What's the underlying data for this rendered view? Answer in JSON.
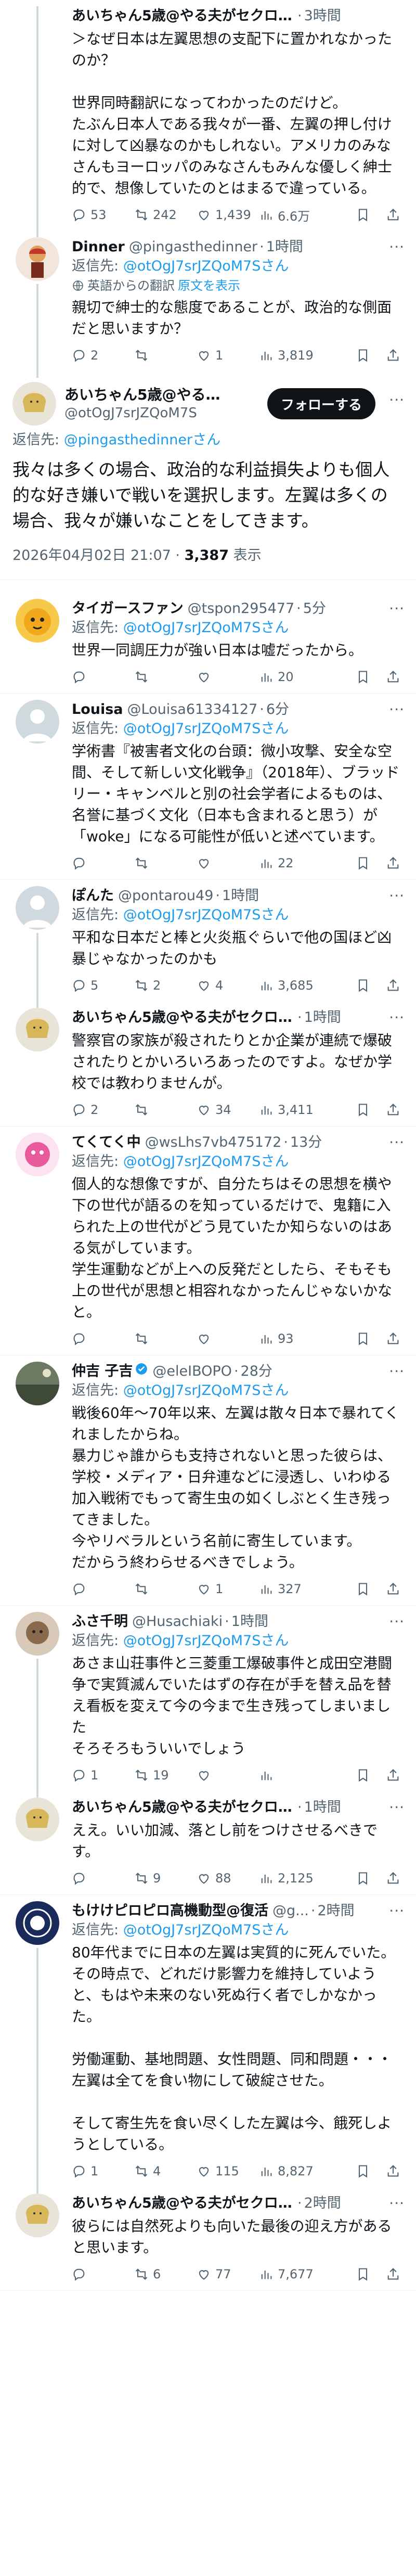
{
  "tweets_top": {
    "t1": {
      "name": "あいちゃん5歳@やる夫がセクロス…",
      "time": "3時間",
      "body": "＞なぜ日本は左翼思想の支配下に置かれなかったのか？\n\n世界同時翻訳になってわかったのだけど。\nたぶん日本人である我々が一番、左翼の押し付けに対して凶暴なのかもしれない。アメリカのみなさんもヨーロッパのみなさんもみんな優しく紳士的で、想像していたのとはまるで違っている。",
      "replies": "53",
      "retweets": "242",
      "likes": "1,439",
      "views": "6.6万"
    },
    "t2": {
      "name": "Dinner",
      "handle": "@pingasthedinner",
      "time": "1時間",
      "reply_to": "@otOgJ7srJZQoM7Sさん",
      "translated": "英語からの翻訳",
      "original": "原文を表示",
      "body": "親切で紳士的な態度であることが、政治的な側面だと思いますか？",
      "replies": "2",
      "retweets": "",
      "likes": "1",
      "views": "3,819"
    }
  },
  "main": {
    "name": "あいちゃん5歳@やる夫...",
    "handle": "@otOgJ7srJZQoM7S",
    "follow": "フォローする",
    "reply_prefix": "返信先: ",
    "reply_to": "@pingasthedinnerさん",
    "body": "我々は多くの場合、政治的な利益損失よりも個人的な好き嫌いで戦いを選択します。左翼は多くの場合、我々が嫌いなことをしてきます。",
    "timestamp": "2026年04月02日 21:07",
    "views_count": "3,387",
    "views_label": "表示"
  },
  "reply_prefix": "返信先: ",
  "replies": [
    {
      "name": "タイガースファン",
      "handle": "@tspon295477",
      "time": "5分",
      "reply_to": "@otOgJ7srJZQoM7Sさん",
      "body": "世界一同調圧力が強い日本は嘘だったから。",
      "replies": "",
      "retweets": "",
      "likes": "",
      "views": "20"
    },
    {
      "name": "Louisa",
      "handle": "@Louisa61334127",
      "time": "6分",
      "reply_to": "@otOgJ7srJZQoM7Sさん",
      "body": "学術書『被害者文化の台頭：微小攻撃、安全な空間、そして新しい文化戦争』（2018年）、ブラッドリー・キャンベルと別の社会学者によるものは、名誉に基づく文化（日本も含まれると思う）が「woke」になる可能性が低いと述べています。",
      "replies": "",
      "retweets": "",
      "likes": "",
      "views": "22"
    },
    {
      "name": "ぽんた",
      "handle": "@pontarou49",
      "time": "1時間",
      "reply_to": "@otOgJ7srJZQoM7Sさん",
      "body": "平和な日本だと棒と火炎瓶ぐらいで他の国ほど凶暴じゃなかったのかも",
      "replies": "5",
      "retweets": "2",
      "likes": "4",
      "views": "3,685"
    },
    {
      "name": "あいちゃん5歳@やる夫がセクロス…",
      "handle": "",
      "time": "1時間",
      "reply_to": "",
      "body": "警察官の家族が殺されたりとか企業が連続で爆破されたりとかいろいろあったのですよ。なぜか学校では教わりませんが。",
      "replies": "2",
      "retweets": "",
      "likes": "34",
      "views": "3,411"
    },
    {
      "name": "てくてく中",
      "handle": "@wsLhs7vb475172",
      "time": "13分",
      "reply_to": "@otOgJ7srJZQoM7Sさん",
      "body": "個人的な想像ですが、自分たちはその思想を横や下の世代が語るのを知っているだけで、鬼籍に入られた上の世代がどう見ていたか知らないのはある気がしています。\n学生運動などが上への反発だとしたら、そもそも上の世代が思想と相容れなかったんじゃないかなと。",
      "replies": "",
      "retweets": "",
      "likes": "",
      "views": "93"
    },
    {
      "name": "仲吉 子吉",
      "handle": "@eleIBOPO",
      "time": "28分",
      "reply_to": "@otOgJ7srJZQoM7Sさん",
      "body": "戦後60年〜70年以来、左翼は散々日本で暴れてくれましたからね。\n暴力じゃ誰からも支持されないと思った彼らは、学校・メディア・日弁連などに浸透し、いわゆる加入戦術でもって寄生虫の如くしぶとく生き残ってきました。\n今やリベラルという名前に寄生しています。\nだからう終わらせるべきでしょう。",
      "replies": "",
      "retweets": "",
      "likes": "1",
      "views": "327"
    },
    {
      "name": "ふさ千明",
      "handle": "@Husachiaki",
      "time": "1時間",
      "reply_to": "@otOgJ7srJZQoM7Sさん",
      "body": "あさま山荘事件と三菱重工爆破事件と成田空港闘争で実質滅んでいたはずの存在が手を替え品を替え看板を変えて今の今まで生き残ってしまいました\nそろそろもういいでしょう",
      "replies": "1",
      "retweets": "19",
      "likes": "",
      "views": ""
    },
    {
      "name": "あいちゃん5歳@やる夫がセクロス…",
      "handle": "",
      "time": "1時間",
      "reply_to": "",
      "body": "ええ。いい加減、落とし前をつけさせるべきです。",
      "replies": "",
      "retweets": "9",
      "likes": "88",
      "views": "2,125"
    },
    {
      "name": "もけけピロピロ高機動型@復活",
      "handle": "@g...",
      "time": "2時間",
      "reply_to": "@otOgJ7srJZQoM7Sさん",
      "body": "80年代までに日本の左翼は実質的に死んでいた。\nその時点で、どれだけ影響力を維持していようと、もはや未来のない死ぬ行く者でしかなかった。\n\n労働運動、基地問題、女性問題、同和問題・・・\n左翼は全てを食い物にして破綻させた。\n\nそして寄生先を食い尽くした左翼は今、餓死しようとしている。",
      "replies": "1",
      "retweets": "4",
      "likes": "115",
      "views": "8,827"
    },
    {
      "name": "あいちゃん5歳@やる夫がセクロス…",
      "handle": "",
      "time": "2時間",
      "reply_to": "",
      "body": "彼らには自然死よりも向いた最後の迎え方があると思います。",
      "replies": "",
      "retweets": "6",
      "likes": "77",
      "views": "7,677"
    }
  ]
}
